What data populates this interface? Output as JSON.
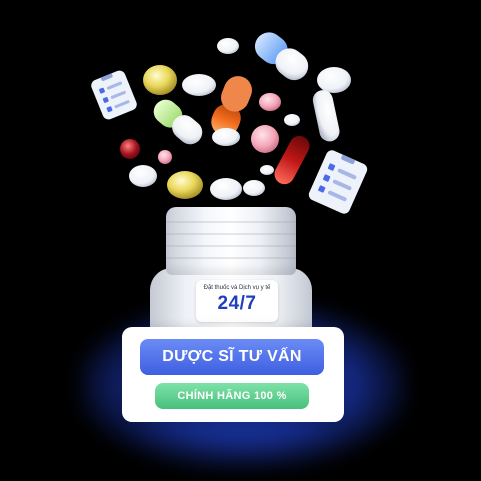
{
  "bottle": {
    "label_caption": "Đặt thuốc và Dịch vụ y tế",
    "label_hours": "24/7"
  },
  "card": {
    "primary_button_label": "DƯỢC SĨ TƯ VẤN",
    "badge_label": "CHÍNH HÃNG 100 %"
  },
  "colors": {
    "primary_blue": "#4a6ae8",
    "badge_green": "#5cd08e",
    "label_text_blue": "#1f3fbf",
    "glow_blue": "#2d5bff",
    "background": "#000000"
  },
  "icons": [
    "clipboard-checklist-icon",
    "capsule-icon",
    "tablet-icon",
    "softgel-icon"
  ]
}
